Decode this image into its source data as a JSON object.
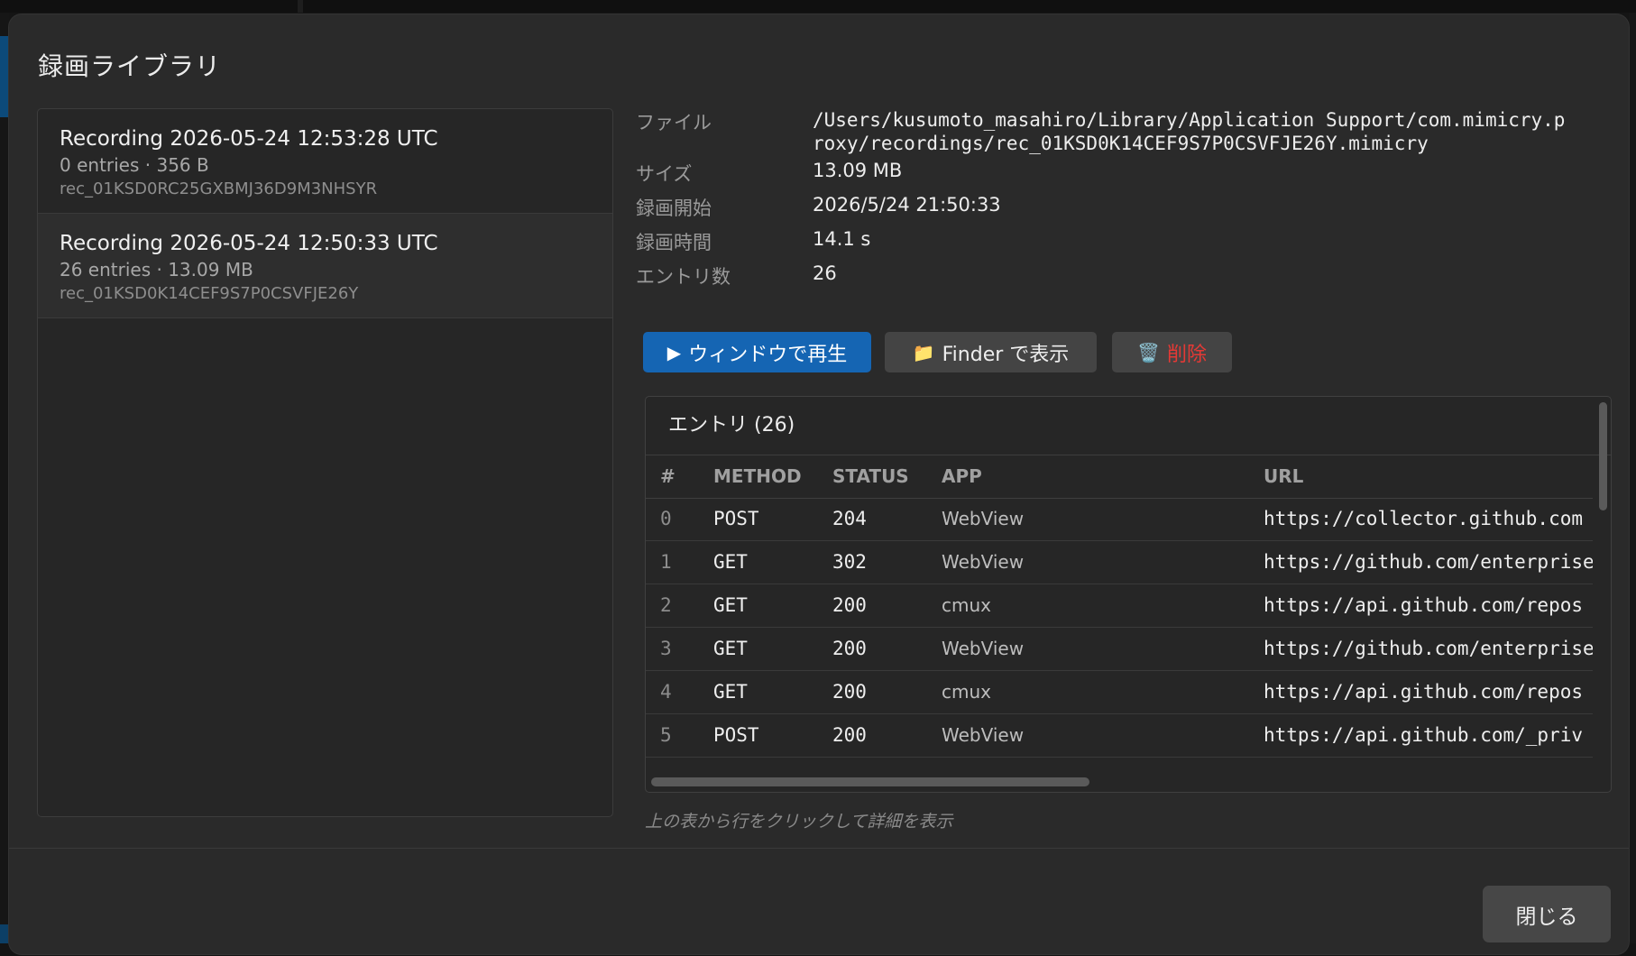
{
  "dialog": {
    "title": "録画ライブラリ",
    "close_label": "閉じる"
  },
  "recordings": [
    {
      "title": "Recording 2026-05-24 12:53:28 UTC",
      "meta": "0 entries · 356 B",
      "id": "rec_01KSD0RC25GXBMJ36D9M3NHSYR",
      "selected": false
    },
    {
      "title": "Recording 2026-05-24 12:50:33 UTC",
      "meta": "26 entries · 13.09 MB",
      "id": "rec_01KSD0K14CEF9S7P0CSVFJE26Y",
      "selected": true
    }
  ],
  "details": {
    "file_label": "ファイル",
    "file_value_line1": "/Users/kusumoto_masahiro/Library/Application Support/com.mimicry.p",
    "file_value_line2": "roxy/recordings/rec_01KSD0K14CEF9S7P0CSVFJE26Y.mimicry",
    "size_label": "サイズ",
    "size_value": "13.09 MB",
    "start_label": "録画開始",
    "start_value": "2026/5/24 21:50:33",
    "duration_label": "録画時間",
    "duration_value": "14.1 s",
    "count_label": "エントリ数",
    "count_value": "26"
  },
  "actions": {
    "play_icon": "▶",
    "play_label": "ウィンドウで再生",
    "finder_icon": "📁",
    "finder_label": "Finder で表示",
    "delete_icon": "🗑️",
    "delete_label": "削除",
    "delete_color": "#e53935",
    "play_color": "#1565b3"
  },
  "entries": {
    "header": "エントリ (26)",
    "columns": [
      "#",
      "METHOD",
      "STATUS",
      "APP",
      "URL"
    ],
    "rows": [
      {
        "idx": "0",
        "method": "POST",
        "status": "204",
        "app": "WebView",
        "url": "https://collector.github.com"
      },
      {
        "idx": "1",
        "method": "GET",
        "status": "302",
        "app": "WebView",
        "url": "https://github.com/enterprise"
      },
      {
        "idx": "2",
        "method": "GET",
        "status": "200",
        "app": "cmux",
        "url": "https://api.github.com/repos"
      },
      {
        "idx": "3",
        "method": "GET",
        "status": "200",
        "app": "WebView",
        "url": "https://github.com/enterprise"
      },
      {
        "idx": "4",
        "method": "GET",
        "status": "200",
        "app": "cmux",
        "url": "https://api.github.com/repos"
      },
      {
        "idx": "5",
        "method": "POST",
        "status": "200",
        "app": "WebView",
        "url": "https://api.github.com/_priv"
      }
    ]
  },
  "hint": "上の表から行をクリックして詳細を表示"
}
